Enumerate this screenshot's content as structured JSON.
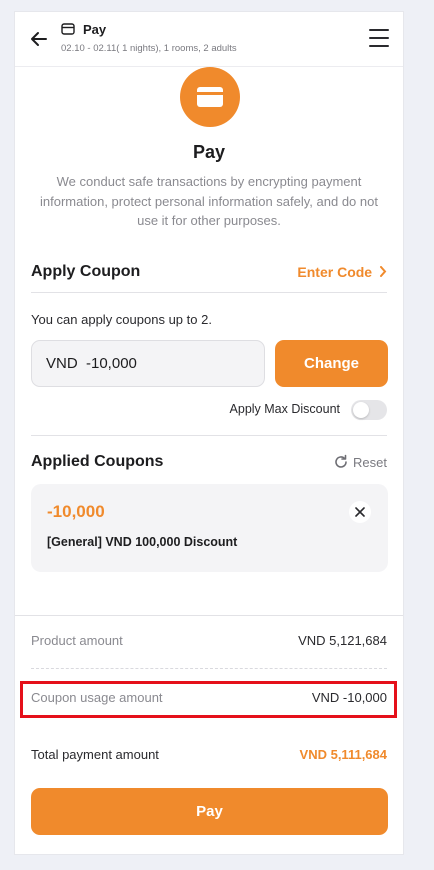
{
  "header": {
    "title": "Pay",
    "subtitle": "02.10 - 02.11( 1 nights), 1 rooms, 2 adults"
  },
  "hero": {
    "title": "Pay",
    "description": "We conduct safe transactions by encrypting payment information, protect personal information safely, and do not use it for other purposes."
  },
  "apply_coupon": {
    "title": "Apply Coupon",
    "enter_code_label": "Enter Code",
    "hint": "You can apply coupons up to 2.",
    "input_value": "VND  -10,000",
    "change_label": "Change",
    "max_discount_label": "Apply Max Discount",
    "max_discount_on": false
  },
  "applied_coupons": {
    "title": "Applied Coupons",
    "reset_label": "Reset",
    "items": [
      {
        "amount": "-10,000",
        "name": "[General] VND 100,000 Discount"
      }
    ]
  },
  "summary": {
    "product_label": "Product amount",
    "product_value": "VND 5,121,684",
    "coupon_label": "Coupon usage amount",
    "coupon_value": "VND -10,000",
    "total_label": "Total payment amount",
    "total_value": "VND 5,111,684"
  },
  "pay_button_label": "Pay",
  "colors": {
    "accent": "#f08a2c",
    "highlight_border": "#e5101a"
  },
  "icons": [
    "back-arrow-icon",
    "card-icon",
    "menu-icon",
    "chevron-right-icon",
    "refresh-icon",
    "close-icon"
  ]
}
